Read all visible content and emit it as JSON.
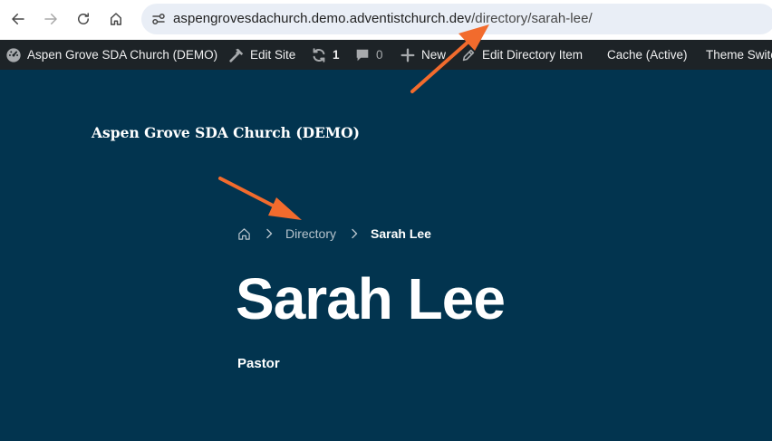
{
  "browser": {
    "url_host": "aspengrovesdachurch.demo.adventistchurch.dev",
    "url_path": "/directory/sarah-lee/",
    "icons": [
      "back-arrow-icon",
      "forward-arrow-icon",
      "reload-icon",
      "home-icon",
      "site-settings-icon"
    ]
  },
  "admin_bar": {
    "site_name": "Aspen Grove SDA Church (DEMO)",
    "edit_site": "Edit Site",
    "updates_count": "1",
    "comments_count": "0",
    "new": "New",
    "edit_item": "Edit Directory Item",
    "cache": "Cache (Active)",
    "theme_switch": "Theme Switc"
  },
  "page": {
    "site_title": "Aspen Grove SDA Church (DEMO)",
    "breadcrumb": {
      "directory": "Directory",
      "current": "Sarah Lee"
    },
    "title": "Sarah Lee",
    "role": "Pastor"
  },
  "colors": {
    "page_bg": "#02344f",
    "admin_bar_bg": "#1d2327",
    "annotation_arrow": "#f26b2d"
  }
}
